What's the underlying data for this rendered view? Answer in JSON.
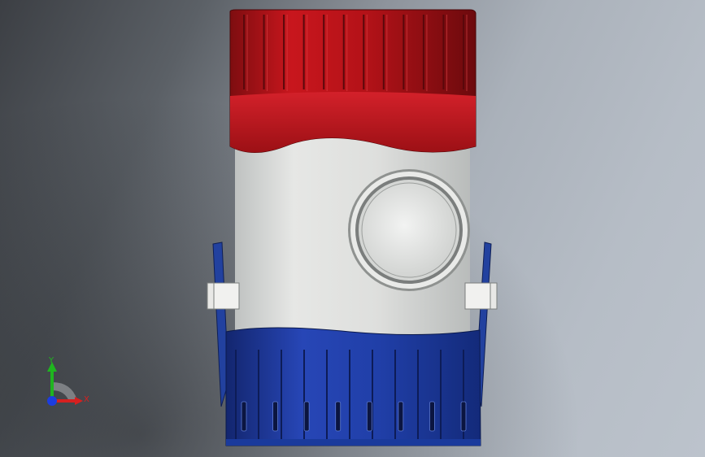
{
  "viewport": {
    "background": "gradient-gray"
  },
  "model": {
    "cap_color": "#c4151c",
    "body_color": "#d9dbd9",
    "base_color": "#1f3fa6",
    "cap_ribs": 12,
    "base_slots": 8
  },
  "triad": {
    "x_label": "X",
    "y_label": "Y",
    "x_color": "#d62020",
    "y_color": "#1fb51f",
    "z_color": "#1c3de0"
  }
}
